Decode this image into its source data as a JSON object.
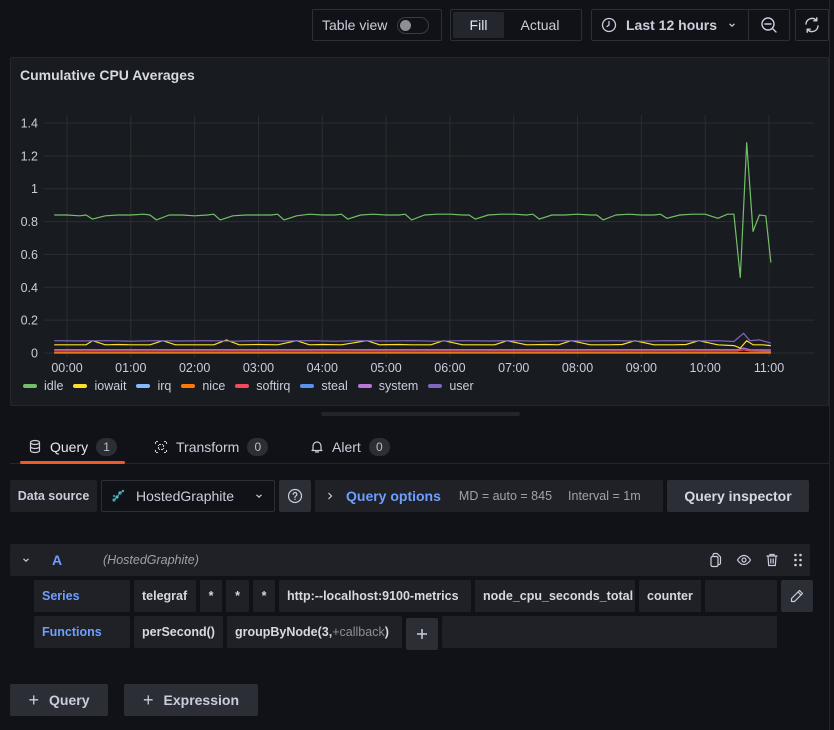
{
  "toolbar": {
    "table_view_label": "Table view",
    "table_view_on": false,
    "fill_label": "Fill",
    "actual_label": "Actual",
    "active_mode": "Fill",
    "time_range": "Last 12 hours",
    "clock_icon": "clock-icon",
    "zoom_out_icon": "zoom-out-icon",
    "refresh_icon": "refresh-icon"
  },
  "panel": {
    "title": "Cumulative CPU Averages"
  },
  "chart_data": {
    "type": "line",
    "title": "Cumulative CPU Averages",
    "xlabel": "",
    "ylabel": "",
    "x_ticks": [
      "00:00",
      "01:00",
      "02:00",
      "03:00",
      "04:00",
      "05:00",
      "06:00",
      "07:00",
      "08:00",
      "09:00",
      "10:00",
      "11:00"
    ],
    "y_ticks": [
      "0",
      "0.2",
      "0.4",
      "0.6",
      "0.8",
      "1",
      "1.2",
      "1.4"
    ],
    "y_tick_values": [
      0,
      0.2,
      0.4,
      0.6,
      0.8,
      1,
      1.2,
      1.4
    ],
    "ylim": [
      0,
      1.5
    ],
    "xlim_hours": [
      -0.35,
      11.7
    ],
    "grid": true,
    "legend_position": "bottom-left",
    "series": [
      {
        "name": "idle",
        "color": "#73bf69",
        "x": [
          -0.2,
          0.0,
          0.2,
          0.3,
          0.4,
          0.6,
          0.8,
          1.0,
          1.2,
          1.3,
          1.4,
          1.6,
          1.8,
          2.0,
          2.2,
          2.3,
          2.4,
          2.6,
          2.8,
          3.0,
          3.2,
          3.3,
          3.4,
          3.6,
          3.8,
          4.0,
          4.2,
          4.3,
          4.4,
          4.6,
          4.8,
          5.0,
          5.2,
          5.3,
          5.4,
          5.6,
          5.8,
          6.0,
          6.2,
          6.3,
          6.4,
          6.6,
          6.8,
          7.0,
          7.2,
          7.3,
          7.4,
          7.6,
          7.8,
          8.0,
          8.2,
          8.3,
          8.4,
          8.6,
          8.8,
          9.0,
          9.2,
          9.3,
          9.4,
          9.6,
          9.8,
          10.0,
          10.2,
          10.35,
          10.45,
          10.55,
          10.65,
          10.75,
          10.85,
          10.95,
          11.03
        ],
        "y": [
          0.84,
          0.84,
          0.835,
          0.84,
          0.815,
          0.835,
          0.84,
          0.84,
          0.845,
          0.84,
          0.81,
          0.84,
          0.84,
          0.835,
          0.84,
          0.845,
          0.81,
          0.835,
          0.84,
          0.84,
          0.84,
          0.845,
          0.81,
          0.835,
          0.845,
          0.84,
          0.84,
          0.845,
          0.815,
          0.84,
          0.845,
          0.84,
          0.84,
          0.845,
          0.81,
          0.84,
          0.845,
          0.845,
          0.84,
          0.84,
          0.815,
          0.84,
          0.845,
          0.845,
          0.84,
          0.845,
          0.815,
          0.84,
          0.84,
          0.845,
          0.84,
          0.84,
          0.81,
          0.84,
          0.845,
          0.84,
          0.84,
          0.845,
          0.82,
          0.84,
          0.845,
          0.845,
          0.82,
          0.845,
          0.845,
          0.46,
          1.28,
          0.74,
          0.84,
          0.835,
          0.55
        ]
      },
      {
        "name": "iowait",
        "color": "#fade2a",
        "x": [
          -0.2,
          0.0,
          0.3,
          0.4,
          0.6,
          0.8,
          1.0,
          1.3,
          1.5,
          1.7,
          2.0,
          2.3,
          2.5,
          2.7,
          3.0,
          3.3,
          3.6,
          3.8,
          4.0,
          4.3,
          4.7,
          4.9,
          5.2,
          5.4,
          5.7,
          5.9,
          6.2,
          6.5,
          6.7,
          6.9,
          7.2,
          7.5,
          7.7,
          7.9,
          8.2,
          8.5,
          8.7,
          8.9,
          9.2,
          9.5,
          9.7,
          9.9,
          10.2,
          10.45,
          10.55,
          10.65,
          10.75,
          10.9,
          11.03
        ],
        "y": [
          0.05,
          0.05,
          0.05,
          0.075,
          0.05,
          0.052,
          0.05,
          0.05,
          0.075,
          0.05,
          0.05,
          0.05,
          0.08,
          0.05,
          0.052,
          0.05,
          0.075,
          0.05,
          0.052,
          0.05,
          0.075,
          0.05,
          0.052,
          0.05,
          0.05,
          0.075,
          0.05,
          0.05,
          0.05,
          0.075,
          0.05,
          0.052,
          0.05,
          0.075,
          0.05,
          0.05,
          0.052,
          0.075,
          0.05,
          0.05,
          0.052,
          0.075,
          0.05,
          0.045,
          0.03,
          0.075,
          0.05,
          0.05,
          0.045
        ]
      },
      {
        "name": "irq",
        "color": "#8ab8ff",
        "x": [
          -0.2,
          11.03
        ],
        "y": [
          0.0,
          0.0
        ]
      },
      {
        "name": "nice",
        "color": "#ff780a",
        "x": [
          -0.2,
          11.03
        ],
        "y": [
          0.002,
          0.002
        ]
      },
      {
        "name": "softirq",
        "color": "#f2495c",
        "x": [
          -0.2,
          10.5,
          10.6,
          10.7,
          11.03
        ],
        "y": [
          0.012,
          0.012,
          0.02,
          0.012,
          0.01
        ]
      },
      {
        "name": "steal",
        "color": "#5794f2",
        "x": [
          -0.2,
          11.03
        ],
        "y": [
          0.001,
          0.001
        ]
      },
      {
        "name": "system",
        "color": "#b877d9",
        "x": [
          -0.2,
          10.5,
          10.6,
          10.7,
          11.03
        ],
        "y": [
          0.02,
          0.02,
          0.03,
          0.02,
          0.018
        ]
      },
      {
        "name": "user",
        "color": "#8066bf",
        "x": [
          -0.2,
          0.2,
          0.6,
          1.0,
          1.4,
          1.8,
          2.2,
          2.6,
          3.0,
          3.4,
          3.8,
          4.2,
          4.6,
          5.0,
          5.4,
          5.8,
          6.2,
          6.6,
          7.0,
          7.4,
          7.8,
          8.2,
          8.6,
          9.0,
          9.4,
          9.8,
          10.2,
          10.45,
          10.6,
          10.7,
          10.85,
          11.03
        ],
        "y": [
          0.075,
          0.073,
          0.075,
          0.072,
          0.075,
          0.073,
          0.075,
          0.072,
          0.075,
          0.073,
          0.075,
          0.072,
          0.075,
          0.073,
          0.075,
          0.072,
          0.075,
          0.073,
          0.075,
          0.072,
          0.075,
          0.073,
          0.075,
          0.072,
          0.075,
          0.073,
          0.075,
          0.07,
          0.12,
          0.075,
          0.08,
          0.06
        ]
      }
    ]
  },
  "tabs": [
    {
      "label": "Query",
      "count": "1",
      "active": true,
      "icon": "database-icon"
    },
    {
      "label": "Transform",
      "count": "0",
      "active": false,
      "icon": "transform-icon"
    },
    {
      "label": "Alert",
      "count": "0",
      "active": false,
      "icon": "bell-icon"
    }
  ],
  "query_options": {
    "data_source_label": "Data source",
    "data_source": "HostedGraphite",
    "options_title": "Query options",
    "md": "MD = auto = 845",
    "interval": "Interval = 1m",
    "inspector_label": "Query inspector"
  },
  "query": {
    "letter": "A",
    "datasource": "(HostedGraphite)",
    "series_label": "Series",
    "series_segments": [
      "telegraf",
      "*",
      "*",
      "*",
      "http:--localhost:9100-metrics",
      "node_cpu_seconds_total",
      "counter"
    ],
    "functions_label": "Functions",
    "functions": [
      "perSecond()"
    ],
    "group_fn": "groupByNode(3,",
    "group_fn_callback": "+callback",
    "group_fn_close": ")"
  },
  "add_buttons": {
    "query": "Query",
    "expression": "Expression"
  }
}
